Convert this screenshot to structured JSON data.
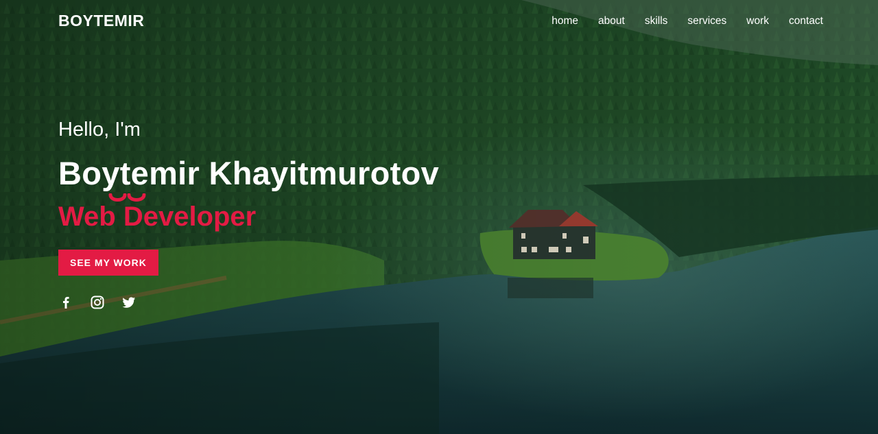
{
  "brand": {
    "logo": "BOYTEMIR",
    "accent_color": "#e31b44"
  },
  "nav": {
    "items": [
      {
        "label": "home"
      },
      {
        "label": "about"
      },
      {
        "label": "skills"
      },
      {
        "label": "services"
      },
      {
        "label": "work"
      },
      {
        "label": "contact"
      }
    ]
  },
  "hero": {
    "greeting": "Hello, I'm",
    "name": "Boytemir Khayitmurotov",
    "role": "Web Developer",
    "cta_label": "SEE MY WORK",
    "socials": [
      {
        "icon": "facebook-icon"
      },
      {
        "icon": "instagram-icon"
      },
      {
        "icon": "twitter-icon"
      }
    ]
  }
}
